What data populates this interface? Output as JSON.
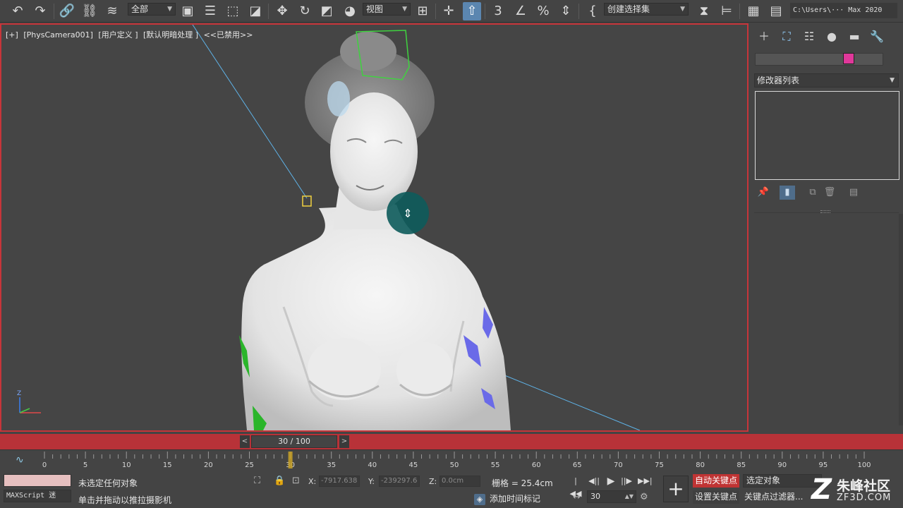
{
  "toolbar": {
    "selection_filter": "全部",
    "reference_coord": "视图",
    "named_selection": "创建选择集",
    "file_path": "C:\\Users\\··· Max 2020"
  },
  "viewport": {
    "labels": [
      "[+]",
      "[PhysCamera001]",
      "[用户定义 ]",
      "[默认明暗处理 ]",
      "<<已禁用>>"
    ],
    "axis_z": "Z"
  },
  "command_panel": {
    "modifier_list": "修改器列表",
    "object_color": "#e0389a"
  },
  "timeline": {
    "slider_label": "30 / 100",
    "prev_glyph": "<",
    "next_glyph": ">",
    "ruler_labels": [
      "0",
      "5",
      "10",
      "15",
      "20",
      "25",
      "30",
      "35",
      "40",
      "45",
      "50",
      "55",
      "60",
      "65",
      "70",
      "75",
      "80",
      "85",
      "90",
      "95",
      "100"
    ],
    "current_frame": 30
  },
  "status": {
    "maxscript_label": "MAXScript 迷",
    "selection_status": "未选定任何对象",
    "prompt": "单击并拖动以推拉摄影机",
    "x_label": "X:",
    "x_value": "-7917.638",
    "y_label": "Y:",
    "y_value": "-239297.6",
    "z_label": "Z:",
    "z_value": "0.0cm",
    "grid": "栅格 = 25.4cm",
    "add_time_tag": "添加时间标记",
    "frame_value": "30",
    "auto_key": "自动关键点",
    "set_key": "设置关键点",
    "selected_object": "选定对象",
    "key_filters": "关键点过滤器...",
    "watermark_name": "朱峰社区",
    "watermark_url": "ZF3D.COM"
  }
}
